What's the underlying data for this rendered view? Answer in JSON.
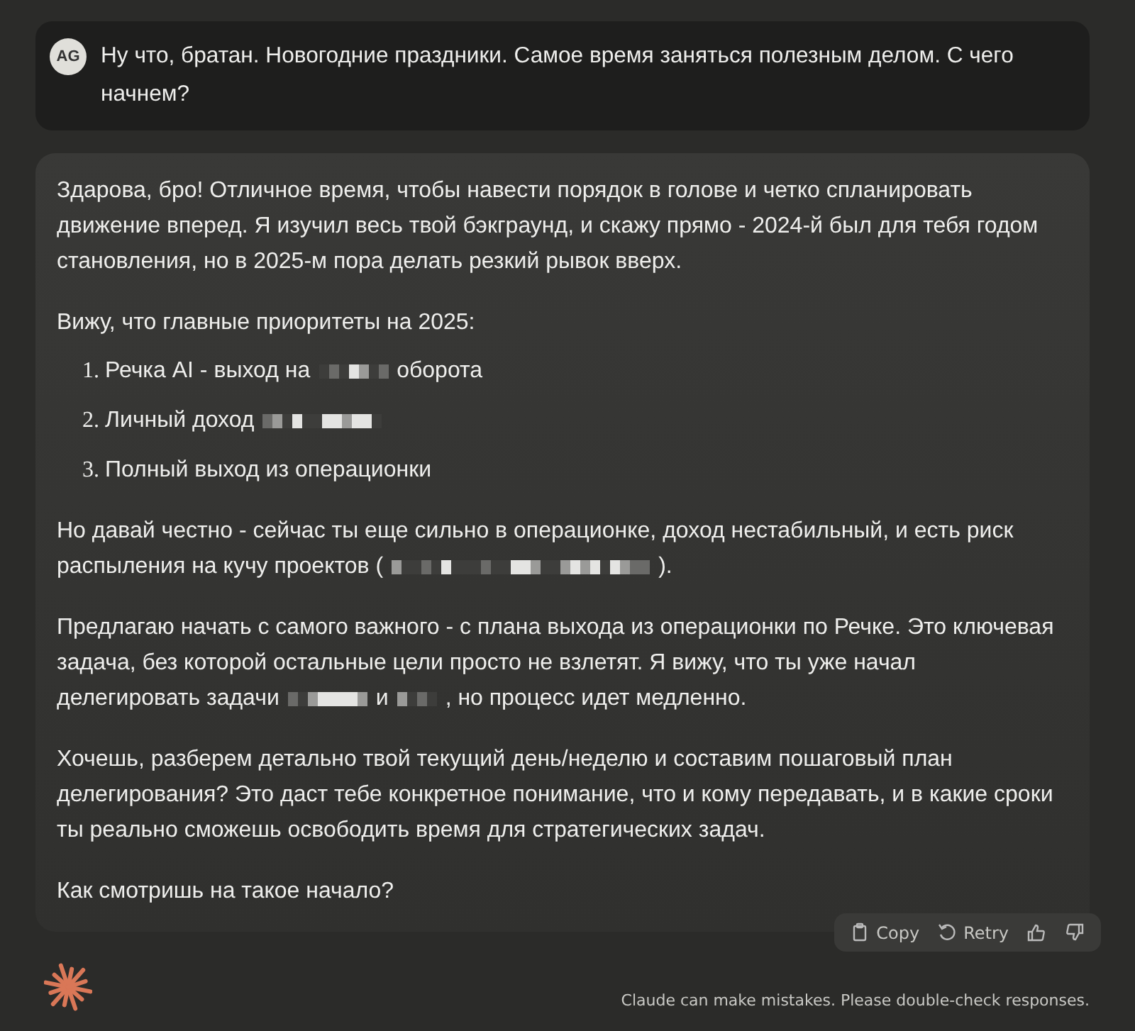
{
  "user_message": {
    "avatar": "AG",
    "text": "Ну что, братан. Новогодние праздники. Самое время заняться полезным делом. С чего начнем?"
  },
  "response": {
    "blocks": [
      {
        "kind": "paragraph",
        "segments": [
          {
            "kind": "text",
            "text": "Здарова, бро! Отличное время, чтобы навести порядок в голове и четко спланировать движение вперед. Я изучил весь твой бэкграунд, и скажу прямо - 2024-й был для тебя годом становления, но в 2025-м пора делать резкий рывок вверх."
          }
        ]
      },
      {
        "kind": "paragraph",
        "segments": [
          {
            "kind": "text",
            "text": "Вижу, что главные приоритеты на 2025:"
          }
        ]
      },
      {
        "kind": "list",
        "items": [
          {
            "number": "1.",
            "segments": [
              {
                "kind": "text",
                "text": "Речка AI - выход на"
              },
              {
                "kind": "redacted"
              },
              {
                "kind": "text",
                "text": "оборота"
              }
            ]
          },
          {
            "number": "2.",
            "segments": [
              {
                "kind": "text",
                "text": "Личный доход"
              },
              {
                "kind": "redacted"
              }
            ]
          },
          {
            "number": "3.",
            "segments": [
              {
                "kind": "text",
                "text": "Полный выход из операционки"
              }
            ]
          }
        ]
      },
      {
        "kind": "paragraph",
        "segments": [
          {
            "kind": "text",
            "text": "Но давай честно - сейчас ты еще сильно в операционке, доход нестабильный, и есть риск распыления на кучу проектов ("
          },
          {
            "kind": "redacted"
          },
          {
            "kind": "text",
            "text": ")."
          }
        ]
      },
      {
        "kind": "paragraph",
        "segments": [
          {
            "kind": "text",
            "text": "Предлагаю начать с самого важного - с плана выхода из операционки по Речке. Это ключевая задача, без которой остальные цели просто не взлетят. Я вижу, что ты уже начал делегировать задачи"
          },
          {
            "kind": "redacted"
          },
          {
            "kind": "text",
            "text": "и"
          },
          {
            "kind": "redacted"
          },
          {
            "kind": "text",
            "text": ", но процесс идет медленно."
          }
        ]
      },
      {
        "kind": "paragraph",
        "segments": [
          {
            "kind": "text",
            "text": "Хочешь, разберем детально твой текущий день/неделю и составим пошаговый план делегирования? Это даст тебе конкретное понимание, что и кому передавать, и в какие сроки ты реально сможешь освободить время для стратегических задач."
          }
        ]
      },
      {
        "kind": "paragraph",
        "segments": [
          {
            "kind": "text",
            "text": "Как смотришь на такое начало?"
          }
        ]
      }
    ],
    "actions": [
      {
        "kind": "copy",
        "label": "Copy"
      },
      {
        "kind": "retry",
        "label": "Retry"
      },
      {
        "kind": "like"
      },
      {
        "kind": "dislike"
      }
    ]
  },
  "disclaimer": "Claude can make mistakes. Please double-check responses."
}
